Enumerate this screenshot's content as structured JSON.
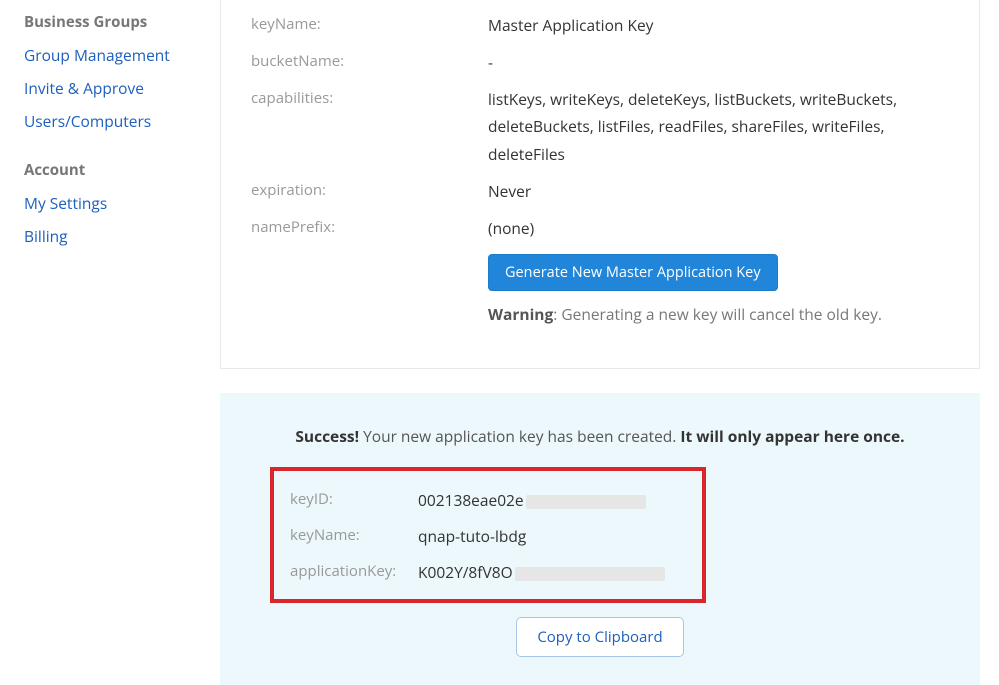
{
  "sidebar": {
    "sections": [
      {
        "heading": "Business Groups",
        "links": [
          "Group Management",
          "Invite & Approve",
          "Users/Computers"
        ]
      },
      {
        "heading": "Account",
        "links": [
          "My Settings",
          "Billing"
        ]
      }
    ]
  },
  "details": {
    "keyName": {
      "label": "keyName:",
      "value": "Master Application Key"
    },
    "bucketName": {
      "label": "bucketName:",
      "value": "-"
    },
    "capabilities": {
      "label": "capabilities:",
      "value": "listKeys, writeKeys, deleteKeys, listBuckets, writeBuckets, deleteBuckets, listFiles, readFiles, shareFiles, writeFiles, deleteFiles"
    },
    "expiration": {
      "label": "expiration:",
      "value": "Never"
    },
    "namePrefix": {
      "label": "namePrefix:",
      "value": "(none)"
    },
    "generateBtn": "Generate New Master Application Key",
    "warningLabel": "Warning",
    "warningText": ": Generating a new key will cancel the old key."
  },
  "success": {
    "lead": "Success!",
    "msg1": " Your new application key has been created. ",
    "msg2": "It will only appear here once.",
    "keyID": {
      "label": "keyID:",
      "value": "002138eae02e"
    },
    "keyName": {
      "label": "keyName:",
      "value": "qnap-tuto-lbdg"
    },
    "applicationKey": {
      "label": "applicationKey:",
      "value": "K002Y/8fV8O"
    },
    "copyBtn": "Copy to Clipboard"
  }
}
